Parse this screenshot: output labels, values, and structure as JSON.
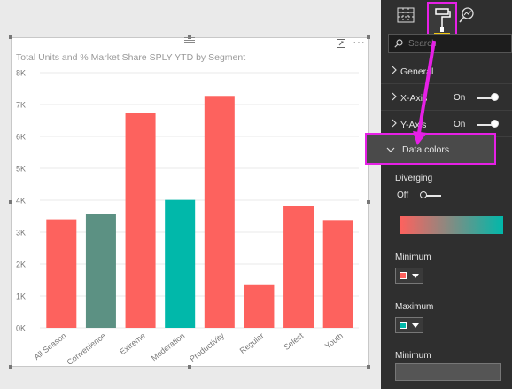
{
  "chart_data": {
    "type": "bar",
    "title": "Total Units and % Market Share SPLY YTD by Segment",
    "categories": [
      "All Season",
      "Convenience",
      "Extreme",
      "Moderation",
      "Productivity",
      "Regular",
      "Select",
      "Youth"
    ],
    "values": [
      3400,
      3580,
      6750,
      4010,
      7270,
      1340,
      3820,
      3380
    ],
    "bar_colors": [
      "#fd625e",
      "#5c9183",
      "#fd625e",
      "#01b8aa",
      "#fd625e",
      "#fd625e",
      "#fd625e",
      "#fd625e"
    ],
    "ylim": [
      0,
      8000
    ],
    "yticks": [
      "0K",
      "1K",
      "2K",
      "3K",
      "4K",
      "5K",
      "6K",
      "7K",
      "8K"
    ],
    "grid": true
  },
  "pane": {
    "search_placeholder": "Search",
    "sections": {
      "general": "General",
      "xaxis": "X-Axis",
      "xaxis_state": "On",
      "yaxis": "Y-Axis",
      "yaxis_state": "On",
      "data_colors": "Data colors"
    },
    "data_colors": {
      "diverging_label": "Diverging",
      "diverging_state": "Off",
      "gradient_start": "#fd625e",
      "gradient_end": "#01b8aa",
      "minimum_label": "Minimum",
      "minimum_color": "#fd625e",
      "maximum_label": "Maximum",
      "maximum_color": "#01b8aa",
      "minimum_value_label": "Minimum"
    }
  },
  "highlight_color": "#e620e6"
}
